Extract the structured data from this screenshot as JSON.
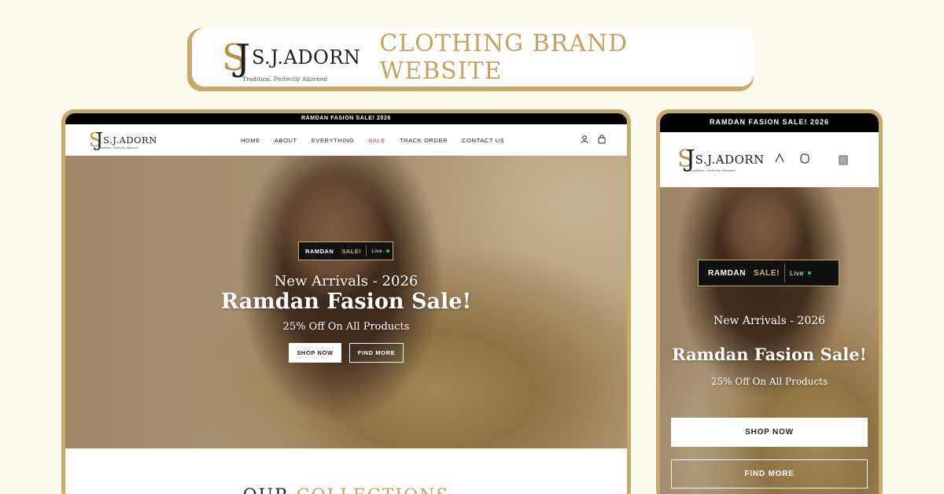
{
  "banner": {
    "logo": {
      "mono_s": "S",
      "mono_j": "J",
      "brand": "S.J.ADORN",
      "tagline": "Tradition, Perfectly Adorned"
    },
    "title": "CLOTHING BRAND WEBSITE"
  },
  "desktop": {
    "announcement": "RAMDAN FASION SALE! 2026",
    "logo": {
      "mono_s": "S",
      "mono_j": "J",
      "brand": "S.J.ADORN",
      "tagline": "Tradition, Perfectly Adorned"
    },
    "nav": [
      "HOME",
      "ABOUT",
      "EVERYTHING",
      "SALE",
      "TRACK ORDER",
      "CONTACT US"
    ],
    "icons": [
      "user-icon",
      "cart-icon"
    ],
    "hero": {
      "badge": {
        "left": "RAMDAN",
        "right": "SALE!",
        "live": "Live"
      },
      "subtitle": "New Arrivals - 2026",
      "title": "Ramdan Fasion Sale!",
      "offer": "25% Off On All Products",
      "shop_button": "SHOP NOW",
      "find_button": "FIND MORE"
    },
    "collections": {
      "first": "OUR",
      "second": "COLLECTIONS"
    }
  },
  "mobile": {
    "announcement": "RAMDAN FASION SALE! 2026",
    "logo": {
      "mono_s": "S",
      "mono_j": "J",
      "brand": "S.J.ADORN",
      "tagline": "Tradition, Perfectly Adorned"
    },
    "icons": [
      "user-icon",
      "search-icon",
      "cart-icon"
    ],
    "hero": {
      "badge": {
        "left": "RAMDAN",
        "right": "SALE!",
        "live": "Live"
      },
      "subtitle": "New Arrivals - 2026",
      "title": "Ramdan Fasion Sale!",
      "offer": "25% Off On All Products",
      "shop_button": "SHOP NOW",
      "find_button": "FIND MORE"
    }
  },
  "colors": {
    "gold": "#c8a968",
    "sale_red": "#c4364c",
    "background": "#fdfbee"
  }
}
